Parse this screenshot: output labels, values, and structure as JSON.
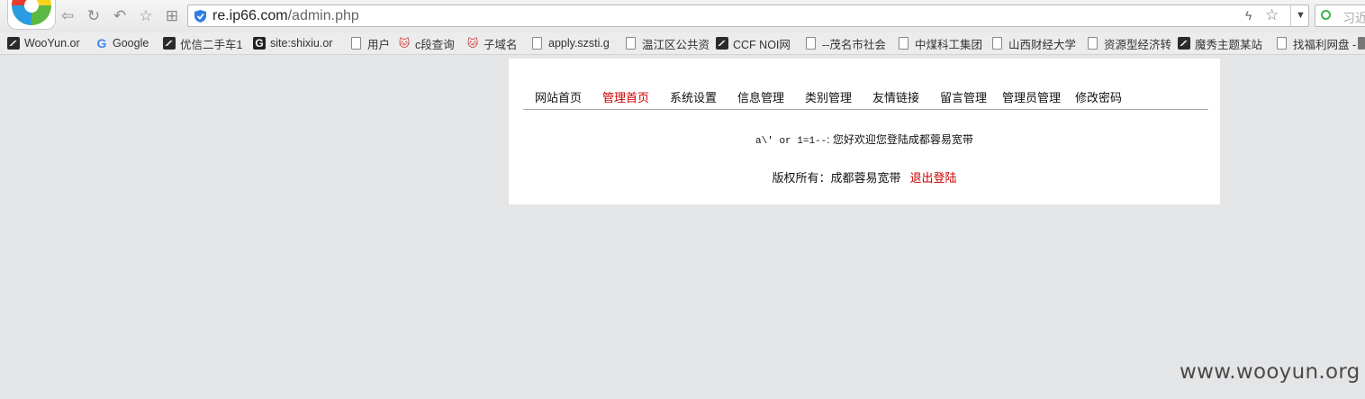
{
  "browser": {
    "url_host": "re.ip66.com",
    "url_path": "/admin.php",
    "search_placeholder": "习近"
  },
  "bookmarks": [
    {
      "label": "WooYun.or",
      "icon": "wooyun-icon"
    },
    {
      "label": "Google",
      "icon": "google-icon"
    },
    {
      "label": "优信二手车1",
      "icon": "wooyun-icon"
    },
    {
      "label": "site:shixiu.or",
      "icon": "g-icon"
    },
    {
      "label": "用户",
      "icon": "page-icon"
    },
    {
      "label": "c段查询",
      "icon": "cat-icon"
    },
    {
      "label": "子域名",
      "icon": "cat-icon"
    },
    {
      "label": "apply.szsti.g",
      "icon": "page-icon"
    },
    {
      "label": "温江区公共资",
      "icon": "page-icon"
    },
    {
      "label": "CCF NOI网",
      "icon": "wooyun-icon"
    },
    {
      "label": "--茂名市社会",
      "icon": "page-icon"
    },
    {
      "label": "中煤科工集团",
      "icon": "page-icon"
    },
    {
      "label": "山西财经大学",
      "icon": "page-icon"
    },
    {
      "label": "资源型经济转",
      "icon": "page-icon"
    },
    {
      "label": "魔秀主题某站",
      "icon": "wooyun-icon"
    },
    {
      "label": "找福利网盘 -",
      "icon": "page-icon"
    }
  ],
  "menu": {
    "items": [
      "网站首页",
      "管理首页",
      "系统设置",
      "信息管理",
      "类别管理",
      "友情链接",
      "留言管理",
      "管理员管理",
      "修改密码"
    ],
    "active_index": 1
  },
  "welcome": {
    "username": "a\\' or 1=1--",
    "text": ": 您好欢迎您登陆成都蓉易宽带"
  },
  "footer": {
    "copyright": "版权所有：成都蓉易宽带",
    "logout": "退出登陆"
  },
  "watermark": "www.wooyun.org",
  "colors": {
    "active": "#cc0000",
    "background": "#e4e5e7"
  }
}
